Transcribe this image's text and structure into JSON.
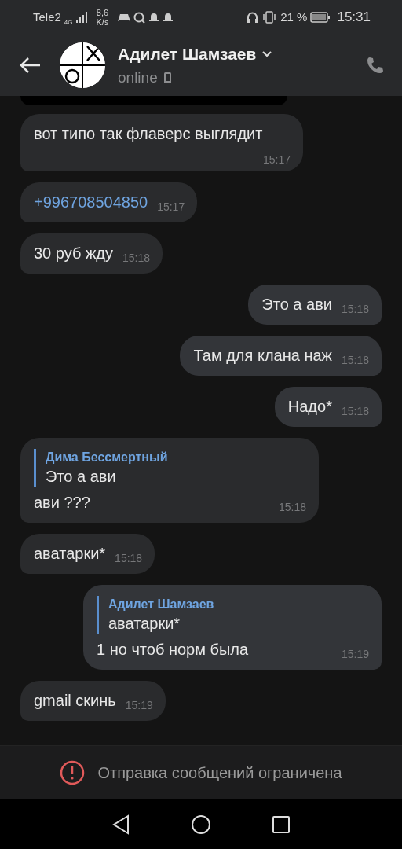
{
  "status_bar": {
    "carrier": "Tele2",
    "network": "4G",
    "speed": "8,6",
    "speed_unit": "K/s",
    "battery": "21 %",
    "time": "15:31"
  },
  "header": {
    "name": "Адилет Шамзаев",
    "status": "online"
  },
  "messages": [
    {
      "kind": "media",
      "outgoing": false
    },
    {
      "kind": "text",
      "outgoing": false,
      "text": "вот типо так флаверс выглядит",
      "time": "15:17"
    },
    {
      "kind": "link",
      "outgoing": false,
      "text": "+996708504850",
      "time": "15:17"
    },
    {
      "kind": "text",
      "outgoing": false,
      "text": "30 руб жду",
      "time": "15:18"
    },
    {
      "kind": "text",
      "outgoing": true,
      "text": "Это а ави",
      "time": "15:18"
    },
    {
      "kind": "text",
      "outgoing": true,
      "text": "Там для клана наж",
      "time": "15:18"
    },
    {
      "kind": "text",
      "outgoing": true,
      "text": "Надо*",
      "time": "15:18"
    },
    {
      "kind": "reply",
      "outgoing": false,
      "quote_author": "Дима Бессмертный",
      "quote_text": "Это а ави",
      "text": "ави ???",
      "time": "15:18"
    },
    {
      "kind": "text",
      "outgoing": false,
      "text": "аватарки*",
      "time": "15:18"
    },
    {
      "kind": "reply",
      "outgoing": true,
      "quote_author": "Адилет Шамзаев",
      "quote_text": "аватарки*",
      "text": "1 но чтоб норм была",
      "time": "15:19"
    },
    {
      "kind": "text",
      "outgoing": false,
      "text": "gmail скинь",
      "time": "15:19"
    }
  ],
  "notice": {
    "text": "Отправка сообщений ограничена"
  }
}
